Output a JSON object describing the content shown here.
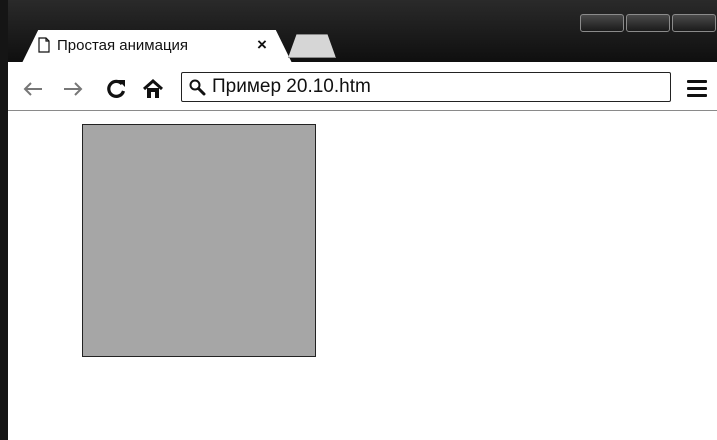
{
  "tab": {
    "title": "Простая анимация",
    "close_label": "×"
  },
  "toolbar": {
    "address_text": "Пример 20.10.htm"
  },
  "icons": {
    "tab_favicon": "page-icon",
    "back": "back-arrow-icon",
    "forward": "forward-arrow-icon",
    "reload": "reload-icon",
    "home": "home-icon",
    "search": "search-icon",
    "menu": "menu-icon"
  },
  "colors": {
    "titlebar": "#151515",
    "box_fill": "#a6a6a6",
    "box_border": "#222222"
  }
}
